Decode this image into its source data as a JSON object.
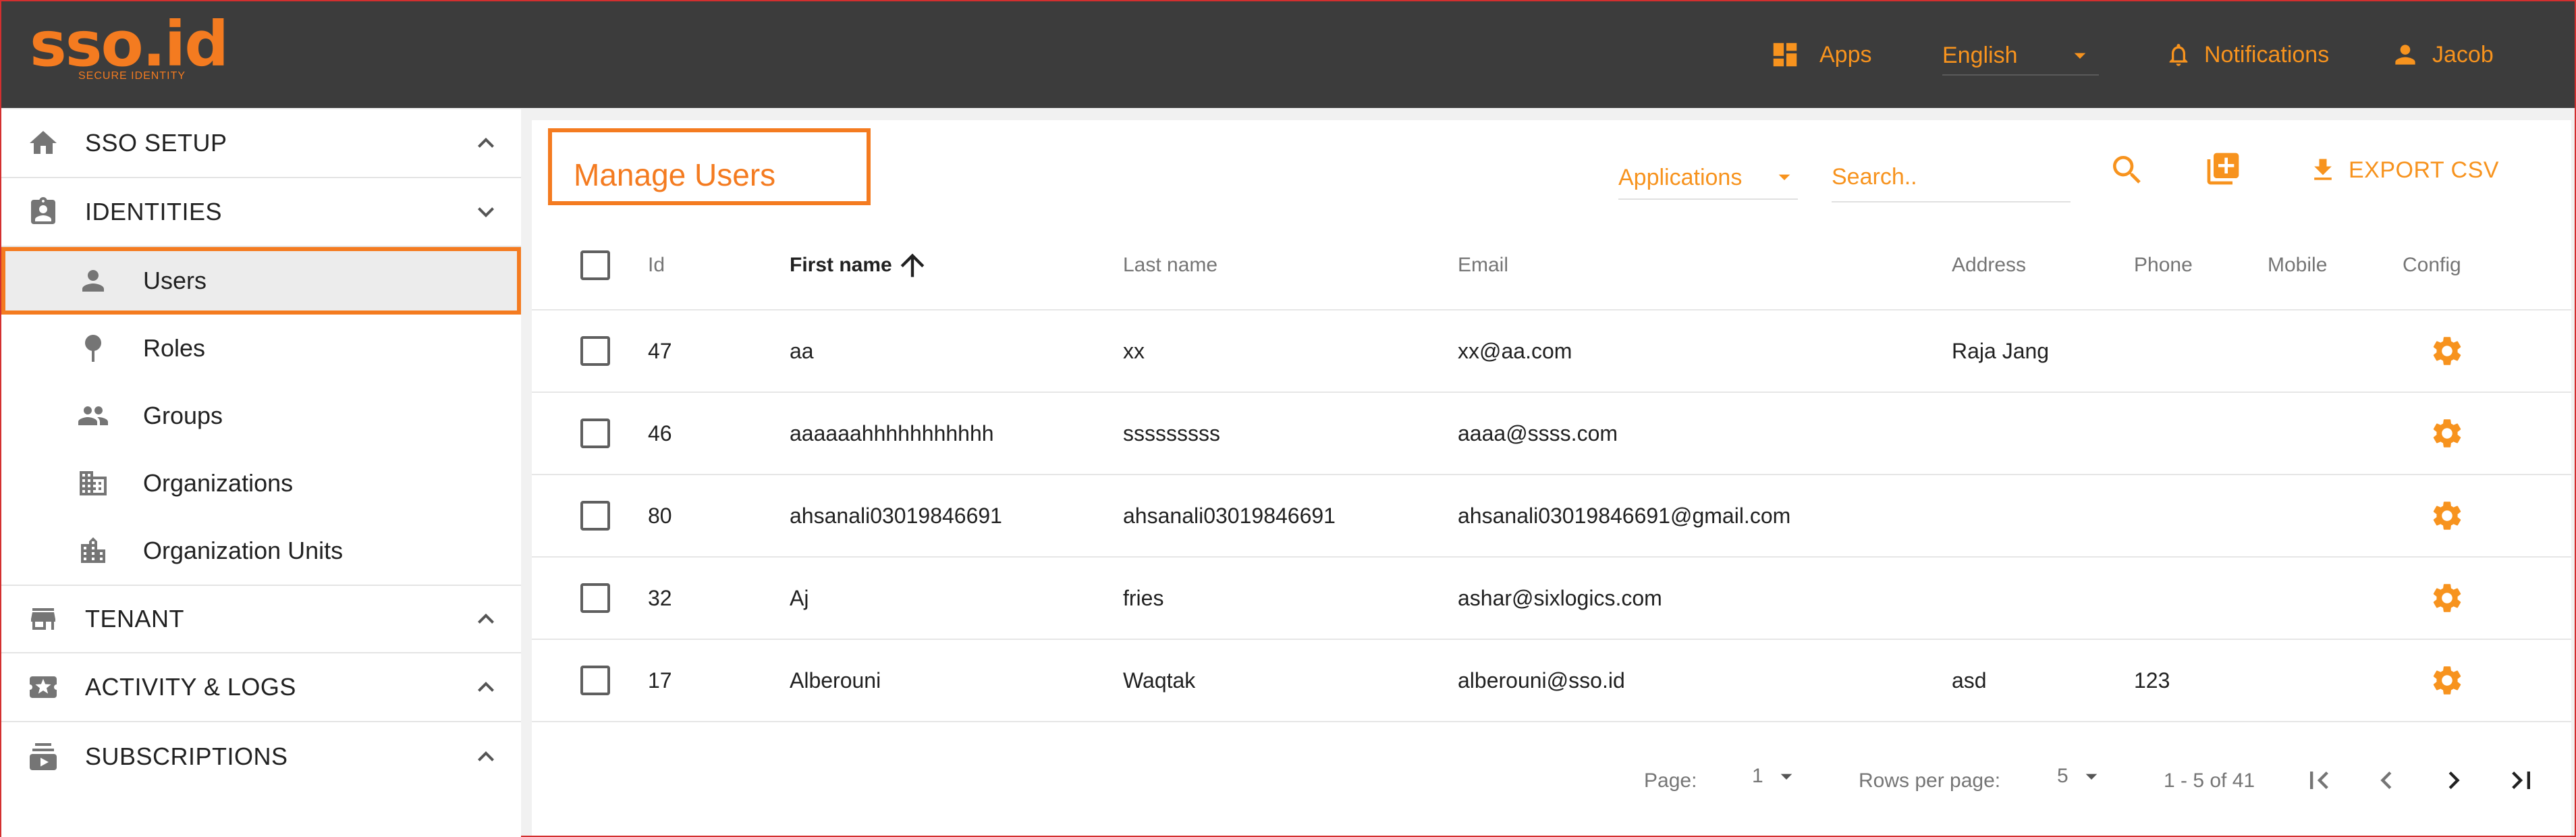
{
  "brand": {
    "logo": "sso.id",
    "tagline": "SECURE IDENTITY",
    "color": "#f47b20"
  },
  "topnav": {
    "apps": "Apps",
    "language": "English",
    "notifications": "Notifications",
    "user": "Jacob"
  },
  "sidebar": {
    "sections": [
      {
        "label": "SSO SETUP",
        "icon": "home-icon",
        "state": "collapsed"
      },
      {
        "label": "IDENTITIES",
        "icon": "badge-icon",
        "state": "expanded"
      },
      {
        "label": "TENANT",
        "icon": "store-icon",
        "state": "collapsed"
      },
      {
        "label": "ACTIVITY & LOGS",
        "icon": "ticket-icon",
        "state": "collapsed"
      },
      {
        "label": "SUBSCRIPTIONS",
        "icon": "subscriptions-icon",
        "state": "collapsed"
      }
    ],
    "identities_items": [
      {
        "label": "Users",
        "icon": "person-icon",
        "active": true
      },
      {
        "label": "Roles",
        "icon": "pin-icon",
        "active": false
      },
      {
        "label": "Groups",
        "icon": "people-icon",
        "active": false
      },
      {
        "label": "Organizations",
        "icon": "business-icon",
        "active": false
      },
      {
        "label": "Organization Units",
        "icon": "domain-icon",
        "active": false
      }
    ]
  },
  "main": {
    "title": "Manage Users",
    "filter_label": "Applications",
    "search_placeholder": "Search..",
    "export_label": "EXPORT CSV"
  },
  "table": {
    "columns": [
      "Id",
      "First name",
      "Last name",
      "Email",
      "Address",
      "Phone",
      "Mobile",
      "Config"
    ],
    "sorted_by": "First name",
    "rows": [
      {
        "id": "47",
        "first": "aa",
        "last": "xx",
        "email": "xx@aa.com",
        "address": "Raja Jang",
        "phone": "",
        "mobile": ""
      },
      {
        "id": "46",
        "first": "aaaaaahhhhhhhhhhh",
        "last": "sssssssss",
        "email": "aaaa@ssss.com",
        "address": "",
        "phone": "",
        "mobile": ""
      },
      {
        "id": "80",
        "first": "ahsanali03019846691",
        "last": "ahsanali03019846691",
        "email": "ahsanali03019846691@gmail.com",
        "address": "",
        "phone": "",
        "mobile": ""
      },
      {
        "id": "32",
        "first": "Aj",
        "last": "fries",
        "email": "ashar@sixlogics.com",
        "address": "",
        "phone": "",
        "mobile": ""
      },
      {
        "id": "17",
        "first": "Alberouni",
        "last": "Waqtak",
        "email": "alberouni@sso.id",
        "address": "asd",
        "phone": "123",
        "mobile": ""
      }
    ]
  },
  "pagination": {
    "page_label": "Page:",
    "page": "1",
    "rows_label": "Rows per page:",
    "rows_per_page": "5",
    "range": "1 - 5 of 41"
  },
  "colors": {
    "accent": "#f7931e",
    "topbar": "#3c3c3c",
    "highlight": "#f47b20"
  }
}
